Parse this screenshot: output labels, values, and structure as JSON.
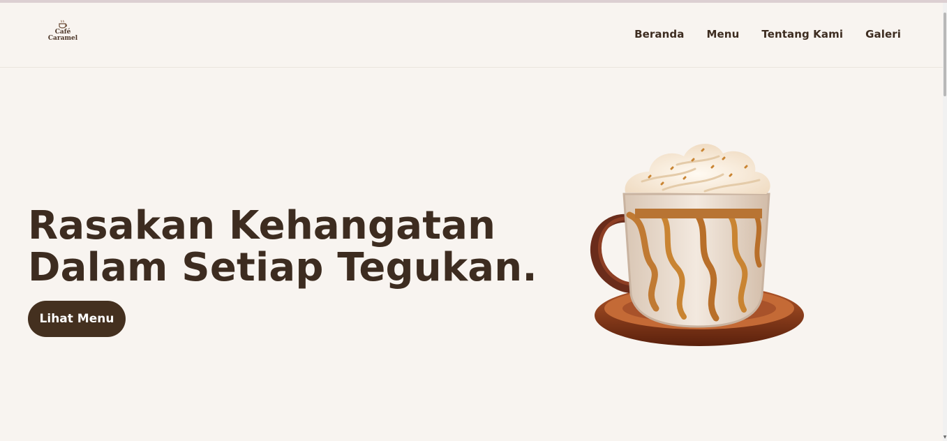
{
  "brand": {
    "line1": "Café",
    "line2": "Caramel"
  },
  "nav": {
    "items": [
      {
        "label": "Beranda"
      },
      {
        "label": "Menu"
      },
      {
        "label": "Tentang Kami"
      },
      {
        "label": "Galeri"
      }
    ]
  },
  "hero": {
    "title_line1": "Rasakan Kehangatan",
    "title_line2": "Dalam Setiap Tegukan.",
    "button_label": "Lihat Menu",
    "image_icon": "caramel-latte-cup"
  },
  "colors": {
    "background": "#f8f4f0",
    "text": "#3d2c20",
    "button": "#44301f"
  }
}
